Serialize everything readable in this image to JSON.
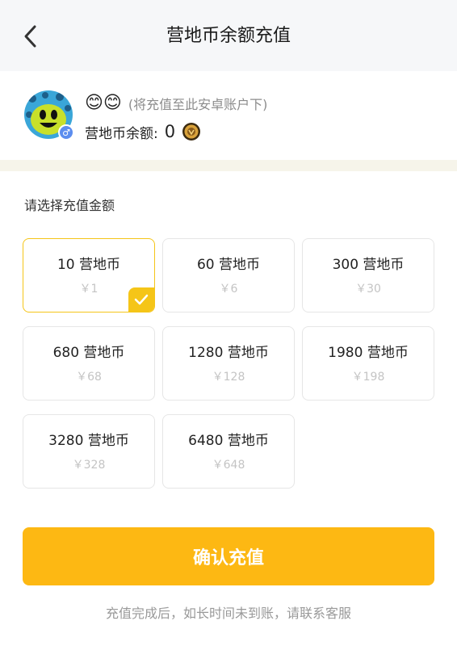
{
  "header": {
    "title": "营地币余额充值",
    "back_icon": "chevron-left-icon"
  },
  "user": {
    "username": "😊😊",
    "account_note": "(将充值至此安卓账户下)",
    "balance_label": "营地币余额:",
    "balance_value": "0",
    "gender_symbol": "♂",
    "gender_color": "#5b8def",
    "coin_icon": "coin-icon"
  },
  "recharge": {
    "section_label": "请选择充值金额",
    "selected_index": 0,
    "options": [
      {
        "coins": "10 营地币",
        "price": "￥1"
      },
      {
        "coins": "60 营地币",
        "price": "￥6"
      },
      {
        "coins": "300 营地币",
        "price": "￥30"
      },
      {
        "coins": "680 营地币",
        "price": "￥68"
      },
      {
        "coins": "1280 营地币",
        "price": "￥128"
      },
      {
        "coins": "1980 营地币",
        "price": "￥198"
      },
      {
        "coins": "3280 营地币",
        "price": "￥328"
      },
      {
        "coins": "6480 营地币",
        "price": "￥648"
      }
    ]
  },
  "confirm": {
    "label": "确认充值"
  },
  "footer": {
    "note": "充值完成后，如长时间未到账，请联系客服"
  },
  "colors": {
    "accent": "#fdb813",
    "selected_border": "#f5c518",
    "muted": "#999999"
  }
}
